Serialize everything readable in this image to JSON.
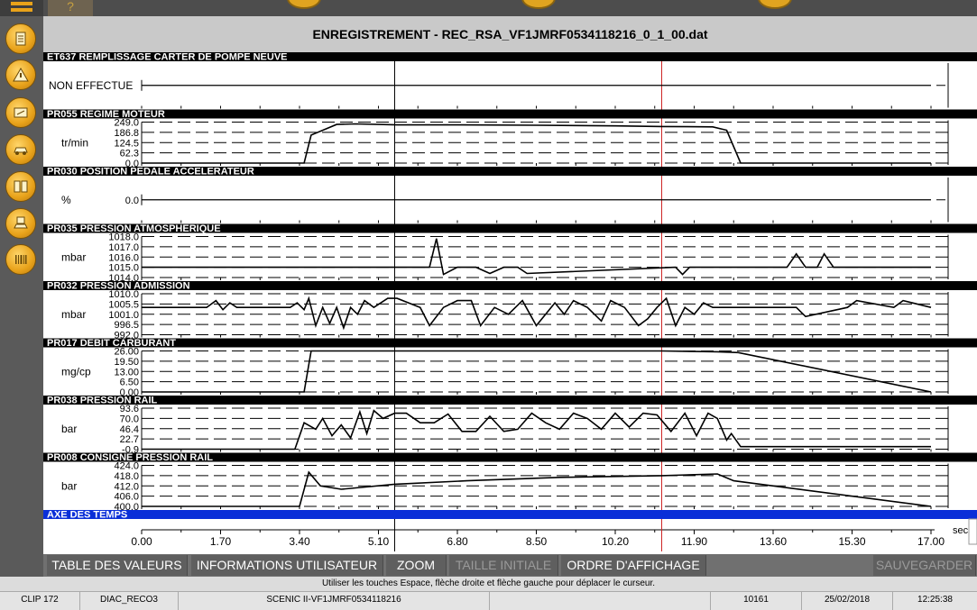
{
  "window_title": "ENREGISTREMENT - REC_RSA_VF1JMRF0534118216_0_1_00.dat",
  "top_help_glyph": "?",
  "sidebar_icons": [
    "document-icon",
    "warning-icon",
    "meter-icon",
    "car-icon",
    "book-icon",
    "car-diagnostic-icon",
    "barcode-icon"
  ],
  "channels": [
    {
      "code": "ET637",
      "name": "REMPLISSAGE CARTER DE POMPE NEUVE",
      "unit": "",
      "state_label": "NON EFFECTUE",
      "type": "state",
      "ticks": []
    },
    {
      "code": "PR055",
      "name": "REGIME MOTEUR",
      "unit": "tr/min",
      "type": "numeric",
      "ticks": [
        "249.0",
        "186.8",
        "124.5",
        "62.3",
        "0.0"
      ],
      "ylim": [
        0,
        249
      ]
    },
    {
      "code": "PR030",
      "name": "POSITION PEDALE ACCELERATEUR",
      "unit": "%",
      "type": "single",
      "ticks": [
        "0.0"
      ]
    },
    {
      "code": "PR035",
      "name": "PRESSION ATMOSPHERIQUE",
      "unit": "mbar",
      "type": "numeric",
      "ticks": [
        "1018.0",
        "1017.0",
        "1016.0",
        "1015.0",
        "1014.0"
      ],
      "ylim": [
        1014,
        1018
      ]
    },
    {
      "code": "PR032",
      "name": "PRESSION ADMISSION",
      "unit": "mbar",
      "type": "numeric",
      "ticks": [
        "1010.0",
        "1005.5",
        "1001.0",
        "996.5",
        "992.0"
      ],
      "ylim": [
        992,
        1010
      ]
    },
    {
      "code": "PR017",
      "name": "DEBIT CARBURANT",
      "unit": "mg/cp",
      "type": "numeric",
      "ticks": [
        "26.00",
        "19.50",
        "13.00",
        "6.50",
        "0.00"
      ],
      "ylim": [
        0,
        26
      ]
    },
    {
      "code": "PR038",
      "name": "PRESSION RAIL",
      "unit": "bar",
      "type": "numeric",
      "ticks": [
        "93.6",
        "70.0",
        "46.4",
        "22.7",
        "-0.9"
      ],
      "ylim": [
        -0.9,
        93.6
      ]
    },
    {
      "code": "PR008",
      "name": "CONSIGNE PRESSION RAIL",
      "unit": "bar",
      "type": "numeric",
      "ticks": [
        "424.0",
        "418.0",
        "412.0",
        "406.0",
        "400.0"
      ],
      "ylim": [
        400,
        424
      ]
    }
  ],
  "time_axis": {
    "label": "AXE DES TEMPS",
    "unit": "sec",
    "ticks": [
      "0.00",
      "1.70",
      "3.40",
      "5.10",
      "6.80",
      "8.50",
      "10.20",
      "11.90",
      "13.60",
      "15.30",
      "17.00"
    ],
    "range": [
      0,
      17
    ],
    "cursor_black_s": 5.45,
    "cursor_red_s": 11.2
  },
  "chart_data": {
    "type": "line",
    "x_label": "AXE DES TEMPS",
    "x_unit": "sec",
    "xlim": [
      0,
      17
    ],
    "series": [
      {
        "name": "PR055 REGIME MOTEUR",
        "x": [
          0,
          3.5,
          3.65,
          4.2,
          4.6,
          5.5,
          6.8,
          8.5,
          10.2,
          11.2,
          12.3,
          12.6,
          12.9,
          17
        ],
        "y": [
          0,
          0,
          170,
          235,
          238,
          232,
          232,
          230,
          226,
          222,
          220,
          200,
          0,
          0
        ]
      },
      {
        "name": "PR030 POSITION PEDALE ACCELERATEUR",
        "x": [
          0,
          17
        ],
        "y": [
          0,
          0
        ]
      },
      {
        "name": "PR035 PRESSION ATMOSPHERIQUE",
        "x": [
          0,
          6.2,
          6.35,
          6.5,
          6.8,
          7.2,
          7.5,
          7.8,
          8.1,
          8.3,
          11.5,
          11.65,
          11.8,
          13.9,
          14.1,
          14.3,
          14.55,
          14.7,
          14.9,
          17
        ],
        "y": [
          1015,
          1015,
          1017.8,
          1014.3,
          1015,
          1015,
          1014.4,
          1015,
          1015,
          1014.4,
          1015,
          1014.3,
          1015,
          1015,
          1016.3,
          1015,
          1015,
          1016.3,
          1015,
          1015
        ]
      },
      {
        "name": "PR032 PRESSION ADMISSION",
        "x": [
          0,
          1.4,
          1.6,
          1.75,
          1.9,
          2.05,
          3.2,
          3.35,
          3.5,
          3.6,
          3.75,
          3.9,
          4.05,
          4.2,
          4.35,
          4.5,
          4.65,
          4.8,
          5.0,
          5.3,
          5.5,
          6.0,
          6.2,
          6.5,
          6.8,
          7.1,
          7.3,
          7.6,
          7.9,
          8.2,
          8.5,
          8.9,
          9.1,
          9.3,
          9.6,
          9.9,
          10.1,
          10.4,
          10.7,
          10.9,
          11.1,
          11.3,
          11.5,
          11.7,
          11.9,
          12.1,
          12.3,
          12.5,
          13.0,
          14.1,
          14.3,
          15.2,
          15.4,
          16.2,
          16.4,
          17
        ],
        "y": [
          1004,
          1004,
          1007,
          1003,
          1006,
          1004,
          1004,
          1006,
          1003,
          1008,
          996,
          1004,
          997,
          1004,
          995,
          1004,
          1001,
          1007,
          1004,
          1008,
          1008,
          1004,
          996,
          1004,
          1007,
          1007,
          996,
          1004,
          1001,
          1007,
          996,
          1006,
          1001,
          1007,
          1004,
          998,
          1007,
          1004,
          996,
          999,
          1004,
          1008,
          996,
          1004,
          1001,
          1006,
          1004,
          1004,
          1004,
          1004,
          1000,
          1004,
          1007,
          1004,
          1007,
          1004
        ]
      },
      {
        "name": "PR017 DEBIT CARBURANT",
        "x": [
          0,
          3.5,
          3.65,
          11.2,
          12.4,
          12.85,
          17
        ],
        "y": [
          0,
          0,
          26,
          26,
          25.5,
          25,
          0
        ]
      },
      {
        "name": "PR038 PRESSION RAIL",
        "x": [
          0,
          3.3,
          3.5,
          3.75,
          3.9,
          4.1,
          4.3,
          4.5,
          4.7,
          4.85,
          5.0,
          5.2,
          5.45,
          5.7,
          6.0,
          6.3,
          6.6,
          6.9,
          7.2,
          7.5,
          7.8,
          8.1,
          8.4,
          8.7,
          9.0,
          9.3,
          9.6,
          9.9,
          10.2,
          10.5,
          10.8,
          11.1,
          11.4,
          11.7,
          11.95,
          12.2,
          12.4,
          12.6,
          12.7,
          12.9,
          17
        ],
        "y": [
          -0.9,
          -0.9,
          60,
          45,
          70,
          30,
          55,
          25,
          85,
          35,
          88,
          70,
          82,
          82,
          60,
          60,
          80,
          40,
          40,
          75,
          40,
          45,
          82,
          60,
          45,
          82,
          70,
          45,
          82,
          50,
          82,
          78,
          40,
          82,
          30,
          82,
          70,
          20,
          35,
          5,
          5
        ]
      },
      {
        "name": "PR008 CONSIGNE PRESSION RAIL",
        "x": [
          0,
          3.4,
          3.6,
          3.85,
          4.3,
          5.45,
          7.0,
          9.0,
          11.2,
          12.4,
          12.75,
          17
        ],
        "y": [
          400,
          400,
          420,
          412,
          410,
          413,
          415,
          417,
          418,
          419,
          415,
          400
        ]
      }
    ]
  },
  "toolbar": {
    "buttons": [
      {
        "label": "TABLE DES VALEURS",
        "enabled": true
      },
      {
        "label": "INFORMATIONS UTILISATEUR",
        "enabled": true
      },
      {
        "label": "ZOOM",
        "enabled": true
      },
      {
        "label": "TAILLE INITIALE",
        "enabled": false
      },
      {
        "label": "ORDRE D'AFFICHAGE",
        "enabled": true
      },
      {
        "label": "SAUVEGARDER",
        "enabled": false
      }
    ]
  },
  "hint_text": "Utiliser les touches Espace, flèche droite et flèche gauche pour déplacer le curseur.",
  "status": {
    "tool": "CLIP 172",
    "module": "DIAC_RECO3",
    "vehicle": "SCENIC II-VF1JMRF0534118216",
    "code": "10161",
    "date": "25/02/2018",
    "time": "12:25:38"
  },
  "colors": {
    "cursor_red": "#cc2222",
    "time_header": "#0a2fd8",
    "sidebar_orange": "#e8a21a"
  }
}
